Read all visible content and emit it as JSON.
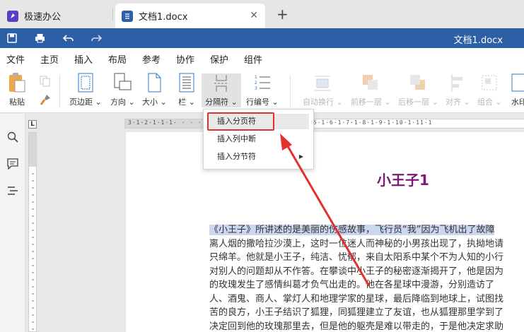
{
  "tabs": {
    "app_title": "极速办公",
    "doc_tab_title": "文档1.docx",
    "close_glyph": "✕",
    "add_glyph": "+"
  },
  "titlebar": {
    "document_name": "文档1.docx"
  },
  "menu": {
    "items": [
      "文件",
      "主页",
      "插入",
      "布局",
      "参考",
      "协作",
      "保护",
      "组件"
    ],
    "active": "布局"
  },
  "ribbon": {
    "paste": "粘贴",
    "margins": "页边距",
    "orientation": "方向",
    "size": "大小",
    "columns": "栏",
    "breaks": "分隔符",
    "line_numbers": "行编号",
    "wrap": "自动换行",
    "bring_forward": "前移一层",
    "send_backward": "后移一层",
    "align": "对齐",
    "group": "组合",
    "watermark": "水印"
  },
  "dropdown": {
    "items": [
      "插入分页符",
      "插入列中断",
      "插入分节符"
    ]
  },
  "ruler": {
    "corner": "L",
    "ticks": "3·1·2·1·1·1·  ·  ·  ·  ·  ·  ·  ·  ·  ·  ·  ·  ·  ·  · 4·1·5·1·6·1·7·1·8·1·9·1·10·1·11·1"
  },
  "document": {
    "title": "小王子1",
    "lines": [
      "《小王子》所讲述的是美丽的伤感故事，飞行员“我”因为飞机出了故障",
      "离人烟的撒哈拉沙漠上，这时一位迷人而神秘的小男孩出现了，执拗地请",
      "只绵羊。他就是小王子，纯洁、忧郁，来自太阳系中某个不为人知的小行",
      "对别人的问题却从不作答。在攀谈中小王子的秘密逐渐揭开了，他是因为",
      "的玫瑰发生了感情纠葛才负气出走的。他在各星球中漫游，分别造访了",
      "人、酒鬼、商人、掌灯人和地理学家的星球，最后降临到地球上，试图找",
      "苦的良方，小王子结识了狐狸，同狐狸建立了友谊，也从狐狸那里学到了",
      "决定回到他的玫瑰那里去，但是他的躯壳是难以带走的，于是他决定求助"
    ]
  },
  "colors": {
    "titlebar": "#2d5fa6",
    "title_text": "#7b1a72",
    "selection": "#c9d7ef",
    "annotation": "#e3302f"
  }
}
